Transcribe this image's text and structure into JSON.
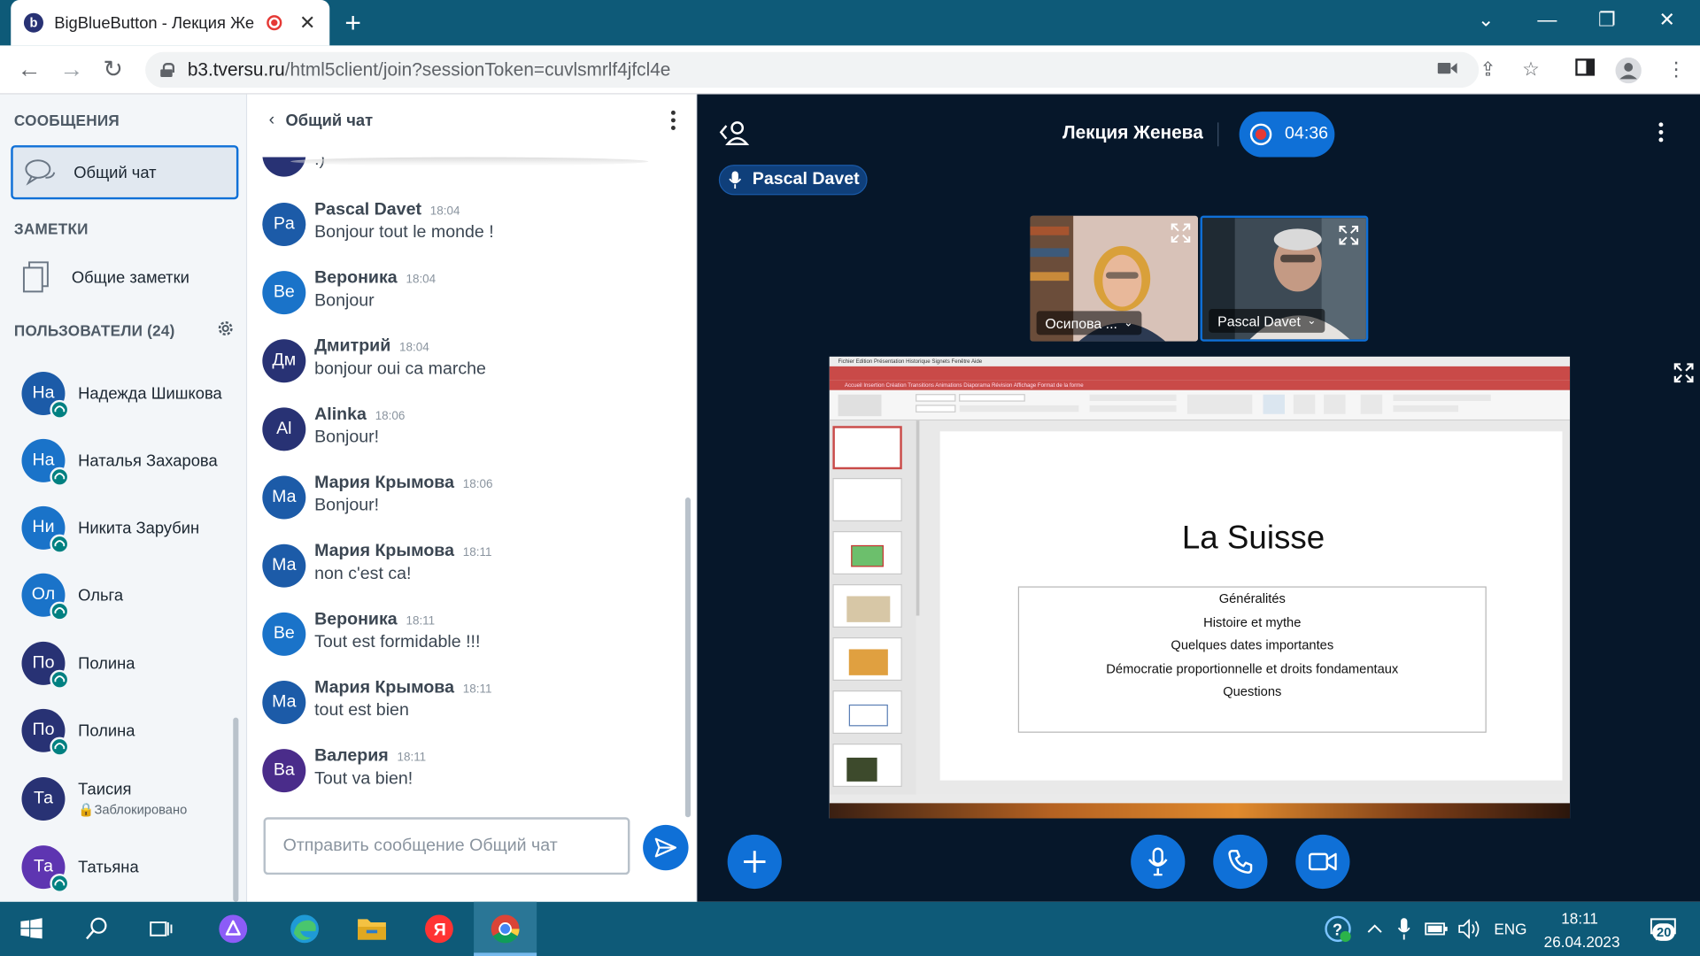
{
  "browser": {
    "tab_title": "BigBlueButton - Лекция Же",
    "tab_favicon_letter": "b",
    "url_host": "b3.tversu.ru",
    "url_path": "/html5client/join?sessionToken=cuvlsmrlf4jfcl4e"
  },
  "left": {
    "messages_heading": "СООБЩЕНИЯ",
    "public_chat_label": "Общий чат",
    "notes_heading": "ЗАМЕТКИ",
    "shared_notes_label": "Общие заметки",
    "users_heading": "ПОЛЬЗОВАТЕЛИ (24)",
    "users": [
      {
        "initials": "На",
        "name": "Надежда Шишкова",
        "color": "#1c5ba8",
        "sub": ""
      },
      {
        "initials": "На",
        "name": "Наталья Захарова",
        "color": "#1a73c9",
        "sub": ""
      },
      {
        "initials": "Ни",
        "name": "Никита Зарубин",
        "color": "#1a73c9",
        "sub": ""
      },
      {
        "initials": "Ол",
        "name": "Ольга",
        "color": "#1a73c9",
        "sub": ""
      },
      {
        "initials": "По",
        "name": "Полина",
        "color": "#283274",
        "sub": ""
      },
      {
        "initials": "По",
        "name": "Полина",
        "color": "#283274",
        "sub": ""
      },
      {
        "initials": "Та",
        "name": "Таисия",
        "color": "#283274",
        "sub": "🔒Заблокировано"
      },
      {
        "initials": "Та",
        "name": "Татьяна",
        "color": "#5e35b1",
        "sub": ""
      }
    ]
  },
  "chat": {
    "title": "Общий чат",
    "first_partial_text": ":)",
    "messages": [
      {
        "initials": "Pa",
        "name": "Pascal Davet",
        "time": "18:04",
        "text": "Bonjour tout le monde !",
        "color": "#1c5ba8"
      },
      {
        "initials": "Ве",
        "name": "Вероника",
        "time": "18:04",
        "text": "Bonjour",
        "color": "#1a73c9"
      },
      {
        "initials": "Дм",
        "name": "Дмитрий",
        "time": "18:04",
        "text": "bonjour oui ca marche",
        "color": "#283274"
      },
      {
        "initials": "Al",
        "name": "Alinka",
        "time": "18:06",
        "text": "Bonjour!",
        "color": "#283274"
      },
      {
        "initials": "Ма",
        "name": "Мария Крымова",
        "time": "18:06",
        "text": "Bonjour!",
        "color": "#1c5ba8"
      },
      {
        "initials": "Ма",
        "name": "Мария Крымова",
        "time": "18:11",
        "text": "non c'est ca!",
        "color": "#1c5ba8"
      },
      {
        "initials": "Ве",
        "name": "Вероника",
        "time": "18:11",
        "text": "Tout est formidable !!!",
        "color": "#1a73c9"
      },
      {
        "initials": "Ма",
        "name": "Мария Крымова",
        "time": "18:11",
        "text": "tout est bien",
        "color": "#1c5ba8"
      },
      {
        "initials": "Ва",
        "name": "Валерия",
        "time": "18:11",
        "text": "Tout va bien!",
        "color": "#4a2c8a"
      }
    ],
    "input_placeholder": "Отправить сообщение Общий чат"
  },
  "main": {
    "meeting_title": "Лекция Женева",
    "recording_time": "04:36",
    "talker": "Pascal Davet",
    "videos": [
      {
        "name": "Осипова ..."
      },
      {
        "name": "Pascal Davet"
      }
    ],
    "slide": {
      "title": "La Suisse",
      "items": [
        "Généralités",
        "Histoire et mythe",
        "Quelques dates importantes",
        "Démocratie proportionnelle et droits fondamentaux",
        "Questions"
      ],
      "mac_menu": "Fichier   Edition   Présentation   Historique   Signets   Fenêtre   Aide",
      "ppt_tabs": "Accueil   Insertion   Création   Transitions   Animations   Diaporama   Révision   Affichage   Format de la forme"
    }
  },
  "taskbar": {
    "lang": "ENG",
    "time": "18:11",
    "date": "26.04.2023",
    "notifications": "20"
  },
  "colors": {
    "accent": "#0f70d7",
    "main_bg": "#06172a",
    "taskbar": "#0e5a78"
  }
}
